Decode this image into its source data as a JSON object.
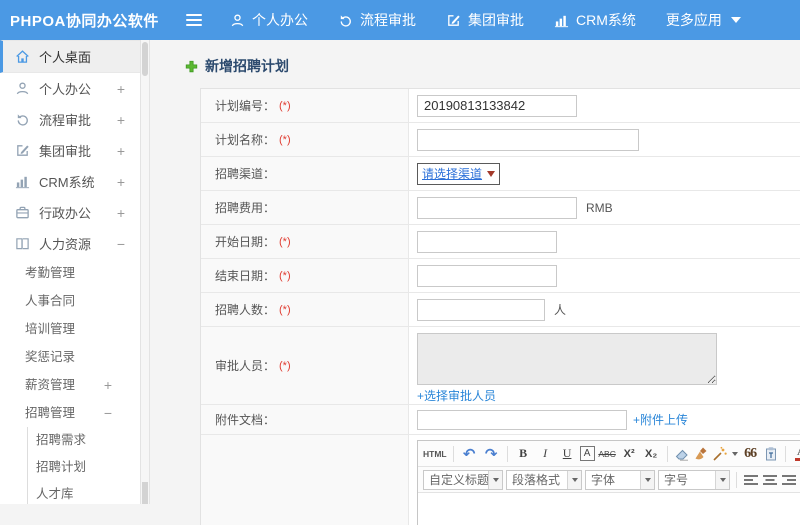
{
  "topbar": {
    "brand": "PHPOA协同办公软件",
    "menu": [
      {
        "label": "个人办公"
      },
      {
        "label": "流程审批"
      },
      {
        "label": "集团审批"
      },
      {
        "label": "CRM系统"
      },
      {
        "label": "更多应用"
      }
    ]
  },
  "sidebar": {
    "items": [
      {
        "label": "个人桌面"
      },
      {
        "label": "个人办公",
        "expand": "+"
      },
      {
        "label": "流程审批",
        "expand": "+"
      },
      {
        "label": "集团审批",
        "expand": "+"
      },
      {
        "label": "CRM系统",
        "expand": "+"
      },
      {
        "label": "行政办公",
        "expand": "+"
      },
      {
        "label": "人力资源",
        "expand": "−"
      }
    ],
    "hr_children": [
      {
        "label": "考勤管理"
      },
      {
        "label": "人事合同"
      },
      {
        "label": "培训管理"
      },
      {
        "label": "奖惩记录"
      },
      {
        "label": "薪资管理",
        "expand": "+"
      },
      {
        "label": "招聘管理",
        "expand": "−"
      }
    ],
    "recruit_children": [
      {
        "label": "招聘需求"
      },
      {
        "label": "招聘计划"
      },
      {
        "label": "人才库"
      }
    ]
  },
  "main": {
    "title": "新增招聘计划",
    "form": {
      "plan_no": {
        "label": "计划编号：",
        "required": "(*)",
        "value": "20190813133842"
      },
      "plan_name": {
        "label": "计划名称：",
        "required": "(*)"
      },
      "channel": {
        "label": "招聘渠道：",
        "select_value": "请选择渠道"
      },
      "fee": {
        "label": "招聘费用：",
        "unit": "RMB"
      },
      "start_date": {
        "label": "开始日期：",
        "required": "(*)"
      },
      "end_date": {
        "label": "结束日期：",
        "required": "(*)"
      },
      "headcount": {
        "label": "招聘人数：",
        "required": "(*)",
        "unit": "人"
      },
      "approver": {
        "label": "审批人员：",
        "required": "(*)",
        "link": "+选择审批人员"
      },
      "attachment": {
        "label": "附件文档：",
        "link": "+附件上传"
      }
    }
  },
  "editor": {
    "toolbar": {
      "html": "HTML",
      "undo": "↶",
      "redo": "↷",
      "bold": "B",
      "italic": "I",
      "underline": "U",
      "autotypeset": "A",
      "strike": "ABC",
      "sup": "X²",
      "sub": "X₂",
      "quote": "66",
      "fontcolor": "A",
      "highlight": "ab"
    },
    "selects": [
      {
        "label": "自定义标题"
      },
      {
        "label": "段落格式"
      },
      {
        "label": "字体"
      },
      {
        "label": "字号"
      }
    ]
  },
  "colors": {
    "accent": "#4b99e4",
    "link": "#2a86d8",
    "required": "#e03c31",
    "title_text": "#2c4a6e",
    "plus_green": "#5cb832"
  }
}
